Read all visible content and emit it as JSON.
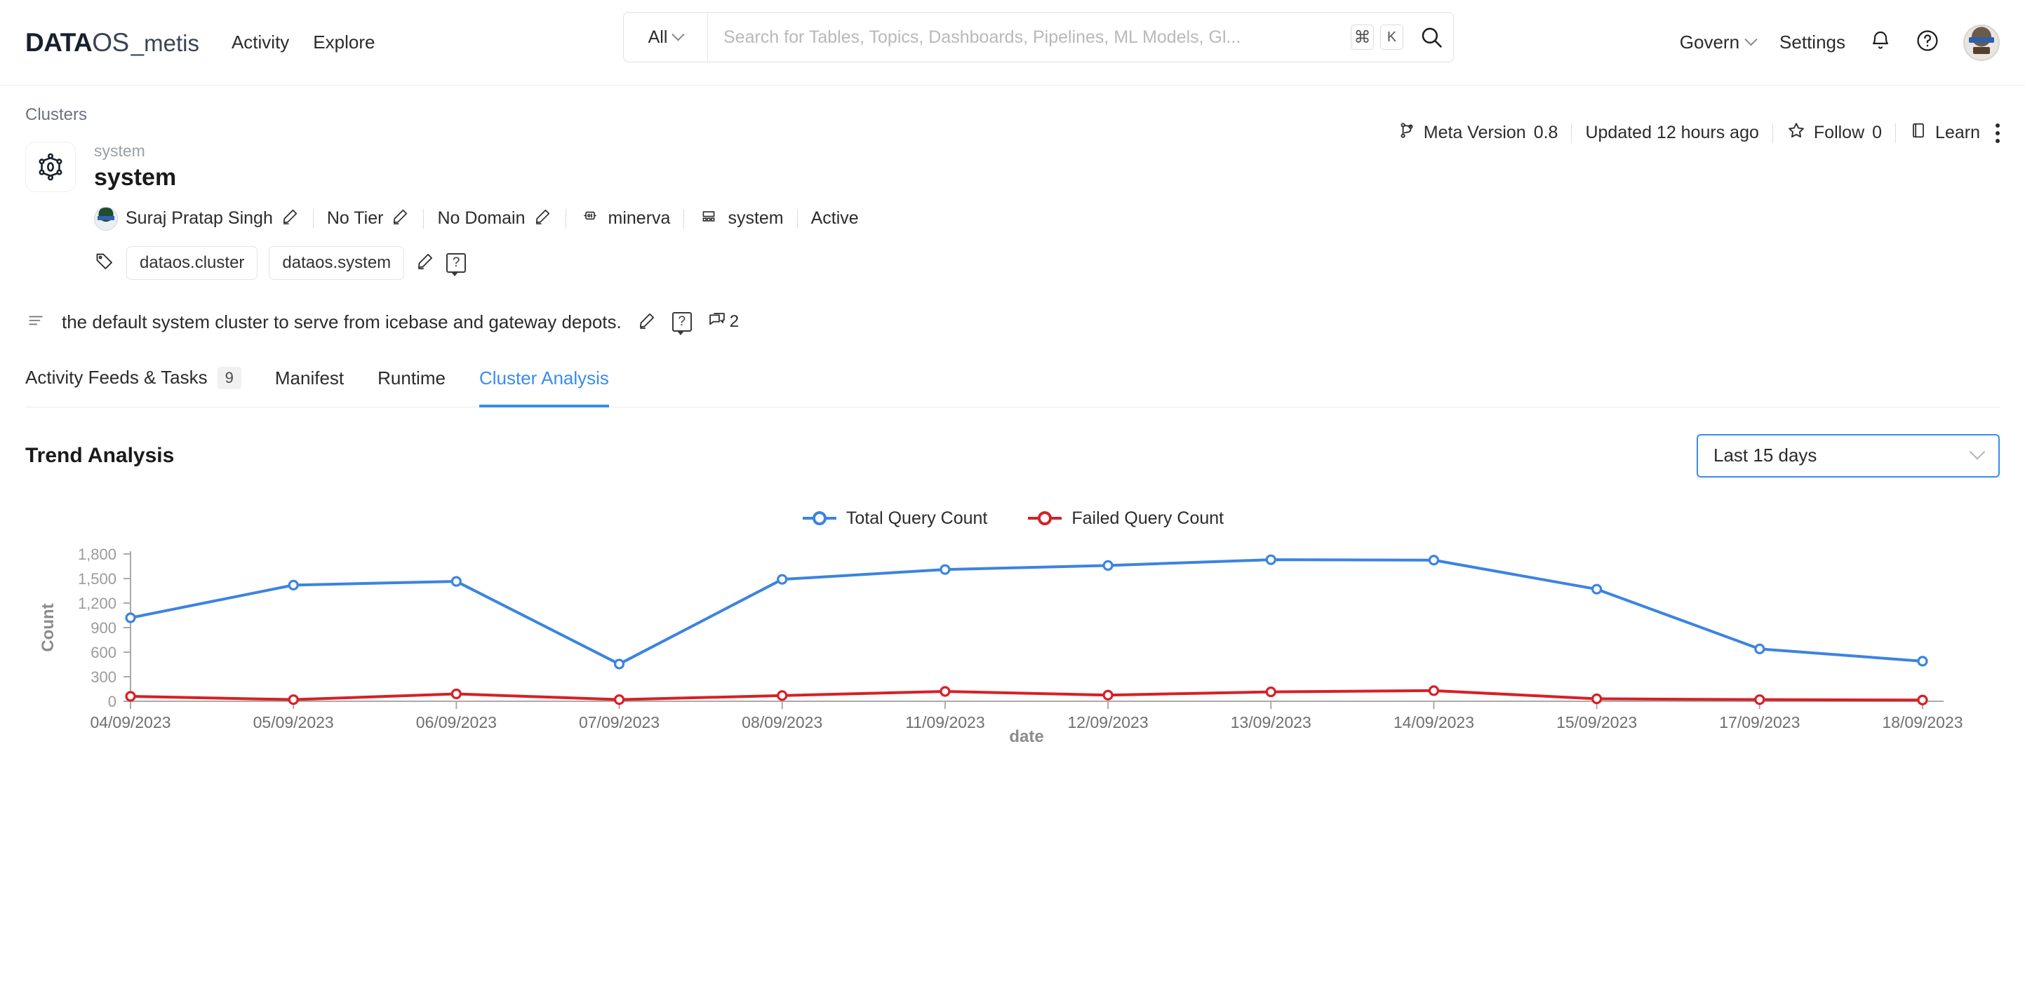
{
  "topnav": {
    "logo": {
      "data": "DATA",
      "os": "OS",
      "suffix": "_metis"
    },
    "links": [
      {
        "label": "Activity",
        "name": "nav-activity"
      },
      {
        "label": "Explore",
        "name": "nav-explore"
      }
    ],
    "search": {
      "scope": "All",
      "placeholder": "Search for Tables, Topics, Dashboards, Pipelines, ML Models, Gl...",
      "value": "",
      "kbd_cmd": "⌘",
      "kbd_key": "K",
      "icon": "search-icon"
    },
    "right": {
      "govern": "Govern",
      "settings": "Settings",
      "bell": "bell-icon",
      "help": "help-circle-icon",
      "avatar": "user-avatar"
    }
  },
  "breadcrumb": {
    "label": "Clusters"
  },
  "entity": {
    "icon": "cluster-icon",
    "subtitle": "system",
    "title": "system",
    "owner": "Suraj Pratap Singh",
    "tier": "No Tier",
    "domain": "No Domain",
    "service": "minerva",
    "cluster": "system",
    "status": "Active",
    "tags": [
      "dataos.cluster",
      "dataos.system"
    ],
    "description": "the default system cluster to serve from icebase and gateway depots.",
    "comment_count": "2"
  },
  "metabar": {
    "meta_version_label": "Meta Version",
    "meta_version_value": "0.8",
    "updated": "Updated 12 hours ago",
    "follow_label": "Follow",
    "follow_count": "0",
    "learn_label": "Learn"
  },
  "tabs": [
    {
      "label": "Activity Feeds & Tasks",
      "badge": "9",
      "active": false,
      "name": "tab-activity-feeds-tasks"
    },
    {
      "label": "Manifest",
      "badge": "",
      "active": false,
      "name": "tab-manifest"
    },
    {
      "label": "Runtime",
      "badge": "",
      "active": false,
      "name": "tab-runtime"
    },
    {
      "label": "Cluster Analysis",
      "badge": "",
      "active": true,
      "name": "tab-cluster-analysis"
    }
  ],
  "trend": {
    "title": "Trend Analysis",
    "range_selected": "Last 15 days"
  },
  "colors": {
    "blue": "#3b84e0",
    "red": "#d62026",
    "accent": "#3a8cf0",
    "axis": "#aaaaaa",
    "tick_text": "#9b9b9b"
  },
  "chart_data": {
    "type": "line",
    "title": "Trend Analysis",
    "xlabel": "date",
    "ylabel": "Count",
    "ylim": [
      0,
      1800
    ],
    "yticks": [
      "0",
      "300",
      "600",
      "900",
      "1,200",
      "1,500",
      "1,800"
    ],
    "grid": false,
    "legend_position": "top-center",
    "categories": [
      "04/09/2023",
      "05/09/2023",
      "06/09/2023",
      "07/09/2023",
      "08/09/2023",
      "11/09/2023",
      "12/09/2023",
      "13/09/2023",
      "14/09/2023",
      "15/09/2023",
      "17/09/2023",
      "18/09/2023"
    ],
    "series": [
      {
        "name": "Total Query Count",
        "color": "#3b84e0",
        "values": [
          1020,
          1420,
          1465,
          455,
          1490,
          1610,
          1660,
          1730,
          1725,
          1370,
          640,
          490
        ]
      },
      {
        "name": "Failed Query Count",
        "color": "#d62026",
        "values": [
          60,
          20,
          90,
          20,
          70,
          120,
          75,
          115,
          130,
          30,
          20,
          15
        ]
      }
    ]
  }
}
